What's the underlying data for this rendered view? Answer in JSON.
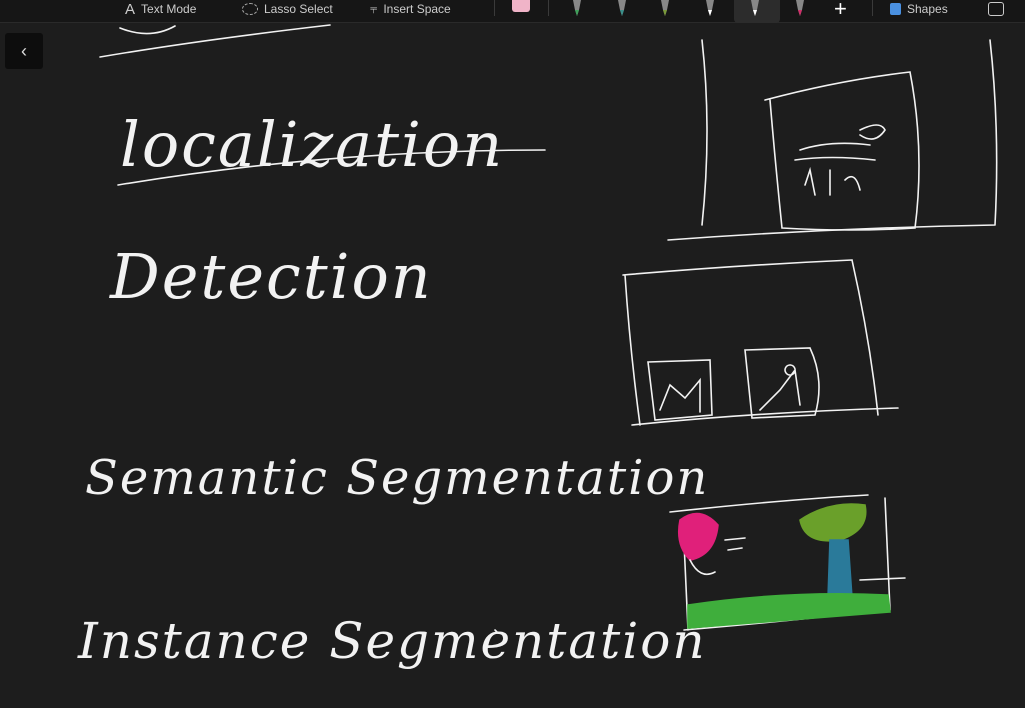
{
  "toolbar": {
    "text_mode": "Text Mode",
    "lasso_select": "Lasso Select",
    "insert_space": "Insert Space",
    "shapes": "Shapes",
    "pen_colors": [
      "#3fa05a",
      "#3a8f8a",
      "#7a9a3a",
      "#ffffff",
      "#ffffff",
      "#d0306a"
    ],
    "eraser_color": "#f0b4c8"
  },
  "back_icon": "chevron-left-icon",
  "notes": {
    "line1": "localization",
    "line2": "Detection",
    "line3": "Semantic Segmentation",
    "line4": "Instance Segmentation"
  },
  "colors": {
    "pink": "#e0207a",
    "green": "#3fae3c",
    "olive": "#6aa02a",
    "blue": "#2a7a9a"
  }
}
